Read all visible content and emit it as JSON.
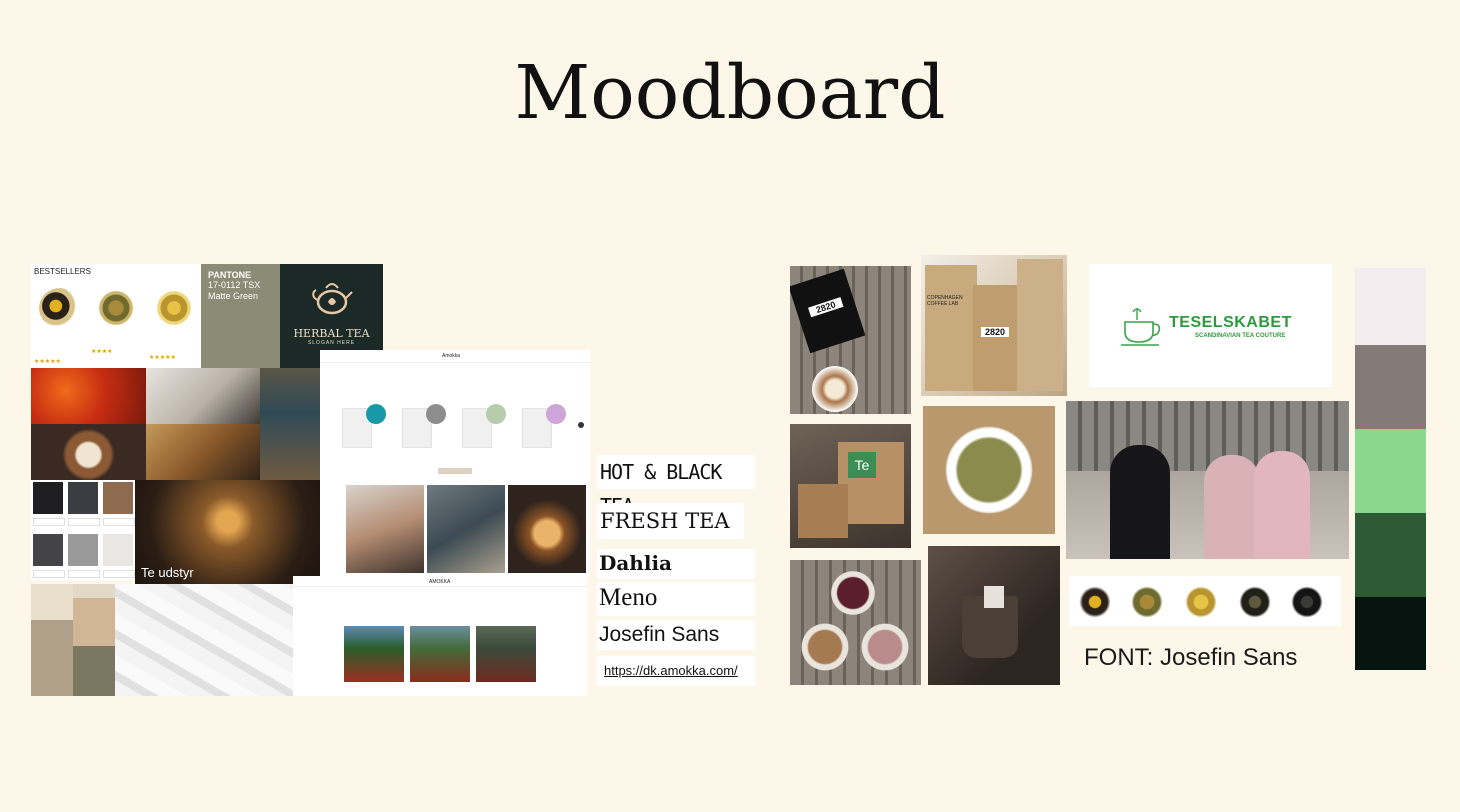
{
  "page": {
    "title": "Moodboard"
  },
  "left_collage": {
    "bestsellers": {
      "header": "BESTSELLERS",
      "top_note": "",
      "products": [
        {
          "name": "",
          "rating": "",
          "price": ""
        },
        {
          "name": "",
          "rating": "",
          "price": ""
        },
        {
          "name": "",
          "rating": "",
          "price": ""
        }
      ]
    },
    "pantone": {
      "brand": "PANTONE",
      "code": "17-0112 TSX",
      "name": "Matte Green",
      "note": "",
      "values": ""
    },
    "herbal_logo": {
      "title": "HERBAL TEA",
      "slogan": "SLOGAN HERE"
    },
    "photo_labels": {
      "tile1": "",
      "tile2": "",
      "tile3": "",
      "tile4": "",
      "te_udstyr": "Te udstyr"
    },
    "amokka_site": {
      "logo": "Amokka",
      "heading": "",
      "cards": [
        "",
        "",
        ""
      ]
    },
    "amokka_site_2": {
      "logo": "AMOKKA",
      "heading": ""
    }
  },
  "fonts": {
    "samples": [
      "HOT & BLACK TEA",
      "FRESH TEA",
      "Dahlia",
      "Meno",
      "Josefin Sans"
    ],
    "link": "https://dk.amokka.com/"
  },
  "right_collage": {
    "bag_label": "2820",
    "coffee_lab": "COPENHAGEN COFFEE LAB",
    "te_box": "Te",
    "logo": {
      "name": "TESELSKABET",
      "tagline": "SCANDINAVIAN TEA COUTURE"
    },
    "font_note": "FONT: Josefin Sans"
  },
  "palette": [
    "#f4ecef",
    "#847a78",
    "#8ad88d",
    "#2d5a32",
    "#061510"
  ]
}
